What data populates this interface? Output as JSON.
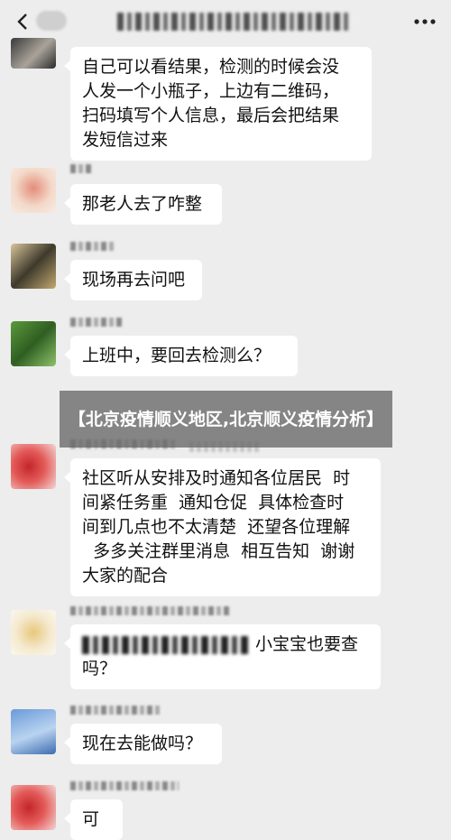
{
  "caption": "【北京疫情顺义地区,北京顺义疫情分析】",
  "messages": [
    {
      "lines": [
        "自己可以看结果，检测的时候会没",
        "人发一个小瓶子，上边有二维码，",
        "扫码填写个人信息，最后会把结果",
        "发短信过来"
      ]
    },
    {
      "lines": [
        "那老人去了咋整"
      ]
    },
    {
      "lines": [
        "现场再去问吧"
      ]
    },
    {
      "lines": [
        "上班中，要回去检测么？"
      ]
    },
    {
      "lines": [
        "社区听从安排及时通知各位居民  时",
        "间紧任务重  通知仓促  具体检查时",
        "间到几点也不太清楚  还望各位理解",
        "  多多关注群里消息  相互告知  谢谢",
        "大家的配合"
      ]
    },
    {
      "tail": "小宝宝也要查",
      "line2": "吗？"
    },
    {
      "lines": [
        "现在去能做吗？"
      ]
    },
    {
      "lines": [
        "可"
      ]
    }
  ],
  "icons": [
    "back-chevron-icon",
    "more-dots-icon"
  ]
}
